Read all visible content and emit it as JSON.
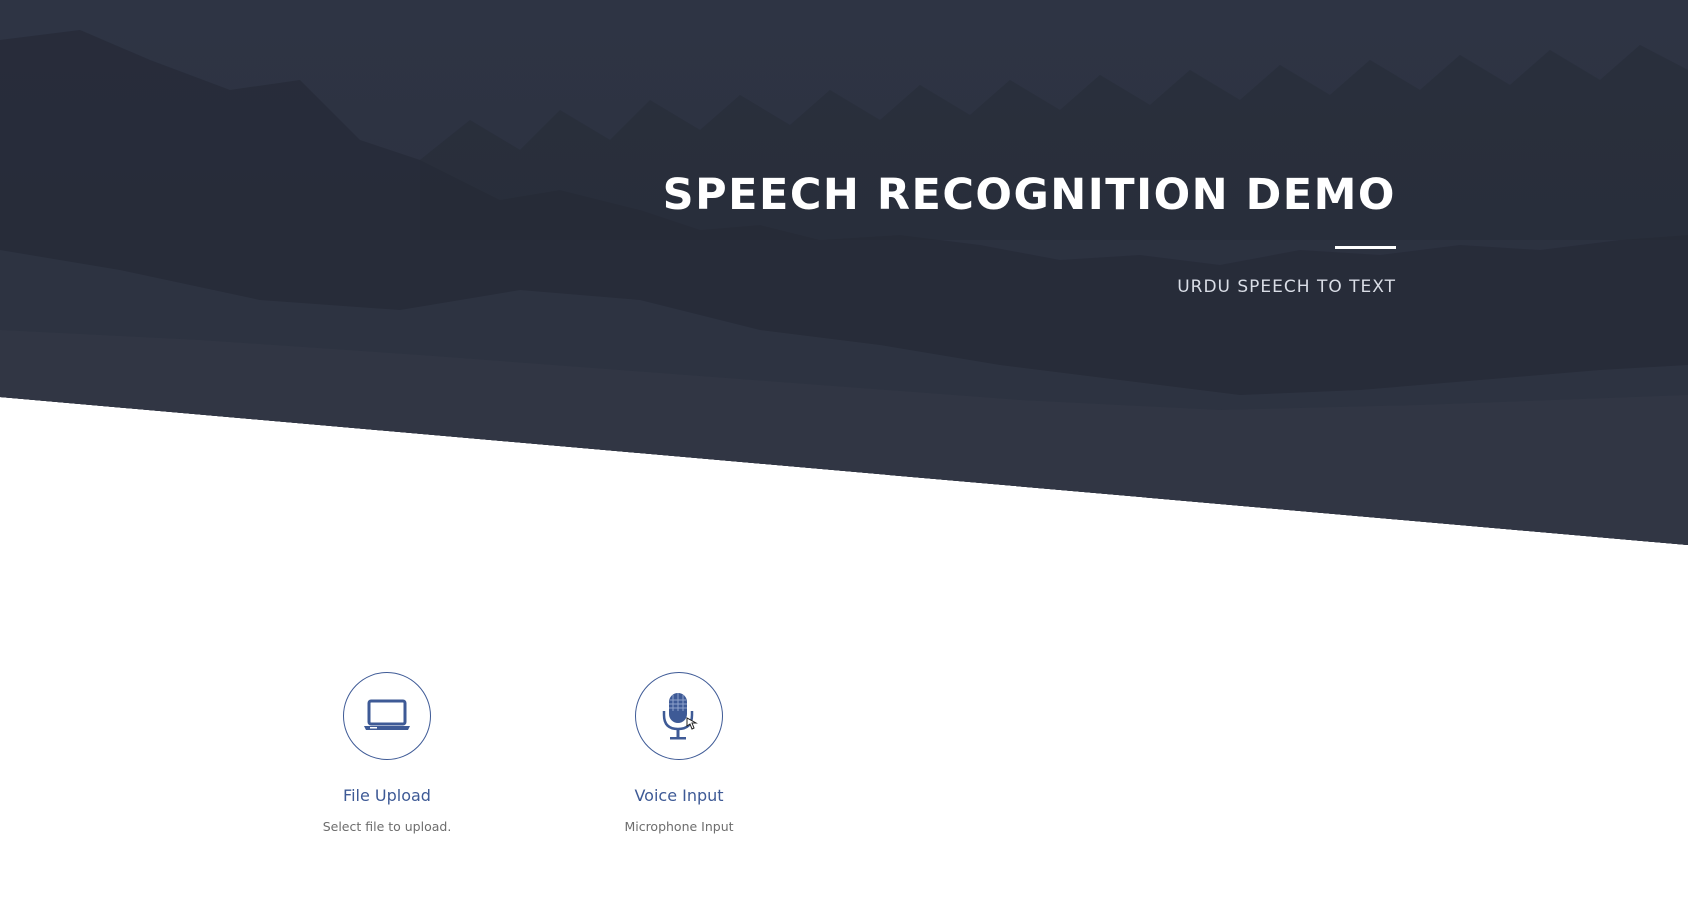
{
  "hero": {
    "title": "SPEECH RECOGNITION DEMO",
    "subtitle": "URDU SPEECH TO TEXT"
  },
  "features": [
    {
      "title": "File Upload",
      "description": "Select file to upload.",
      "icon": "laptop-icon"
    },
    {
      "title": "Voice Input",
      "description": "Microphone Input",
      "icon": "microphone-icon"
    }
  ],
  "colors": {
    "hero_background": "#2c3240",
    "accent": "#3e5a96",
    "text_muted": "#6d6d6d",
    "white": "#ffffff"
  }
}
